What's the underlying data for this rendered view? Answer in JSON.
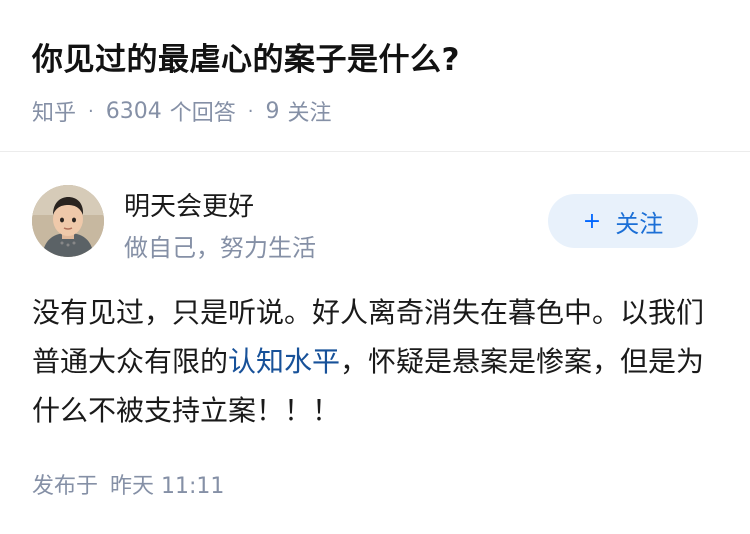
{
  "question": {
    "title": "你见过的最虐心的案子是什么?",
    "source": "知乎",
    "answer_count": "6304",
    "answer_label": "个回答",
    "follow_count": "9",
    "follow_label": "关注",
    "separator": "·"
  },
  "author": {
    "name": "明天会更好",
    "bio": "做自己，努力生活",
    "follow_button_plus": "+",
    "follow_button_label": "关注"
  },
  "answer": {
    "text_before_link": "没有见过，只是听说。好人离奇消失在暮色中。以我们普通大众有限的",
    "link_text": "认知水平",
    "text_after_link": "，怀疑是悬案是惨案，但是为什么不被支持立案！！！"
  },
  "footer": {
    "publish_label": "发布于",
    "publish_time": "昨天 11:11"
  },
  "colors": {
    "meta": "#8590a6",
    "link": "#175199",
    "follow_bg": "#e8f1fb",
    "follow_text": "#1b6fd6"
  }
}
